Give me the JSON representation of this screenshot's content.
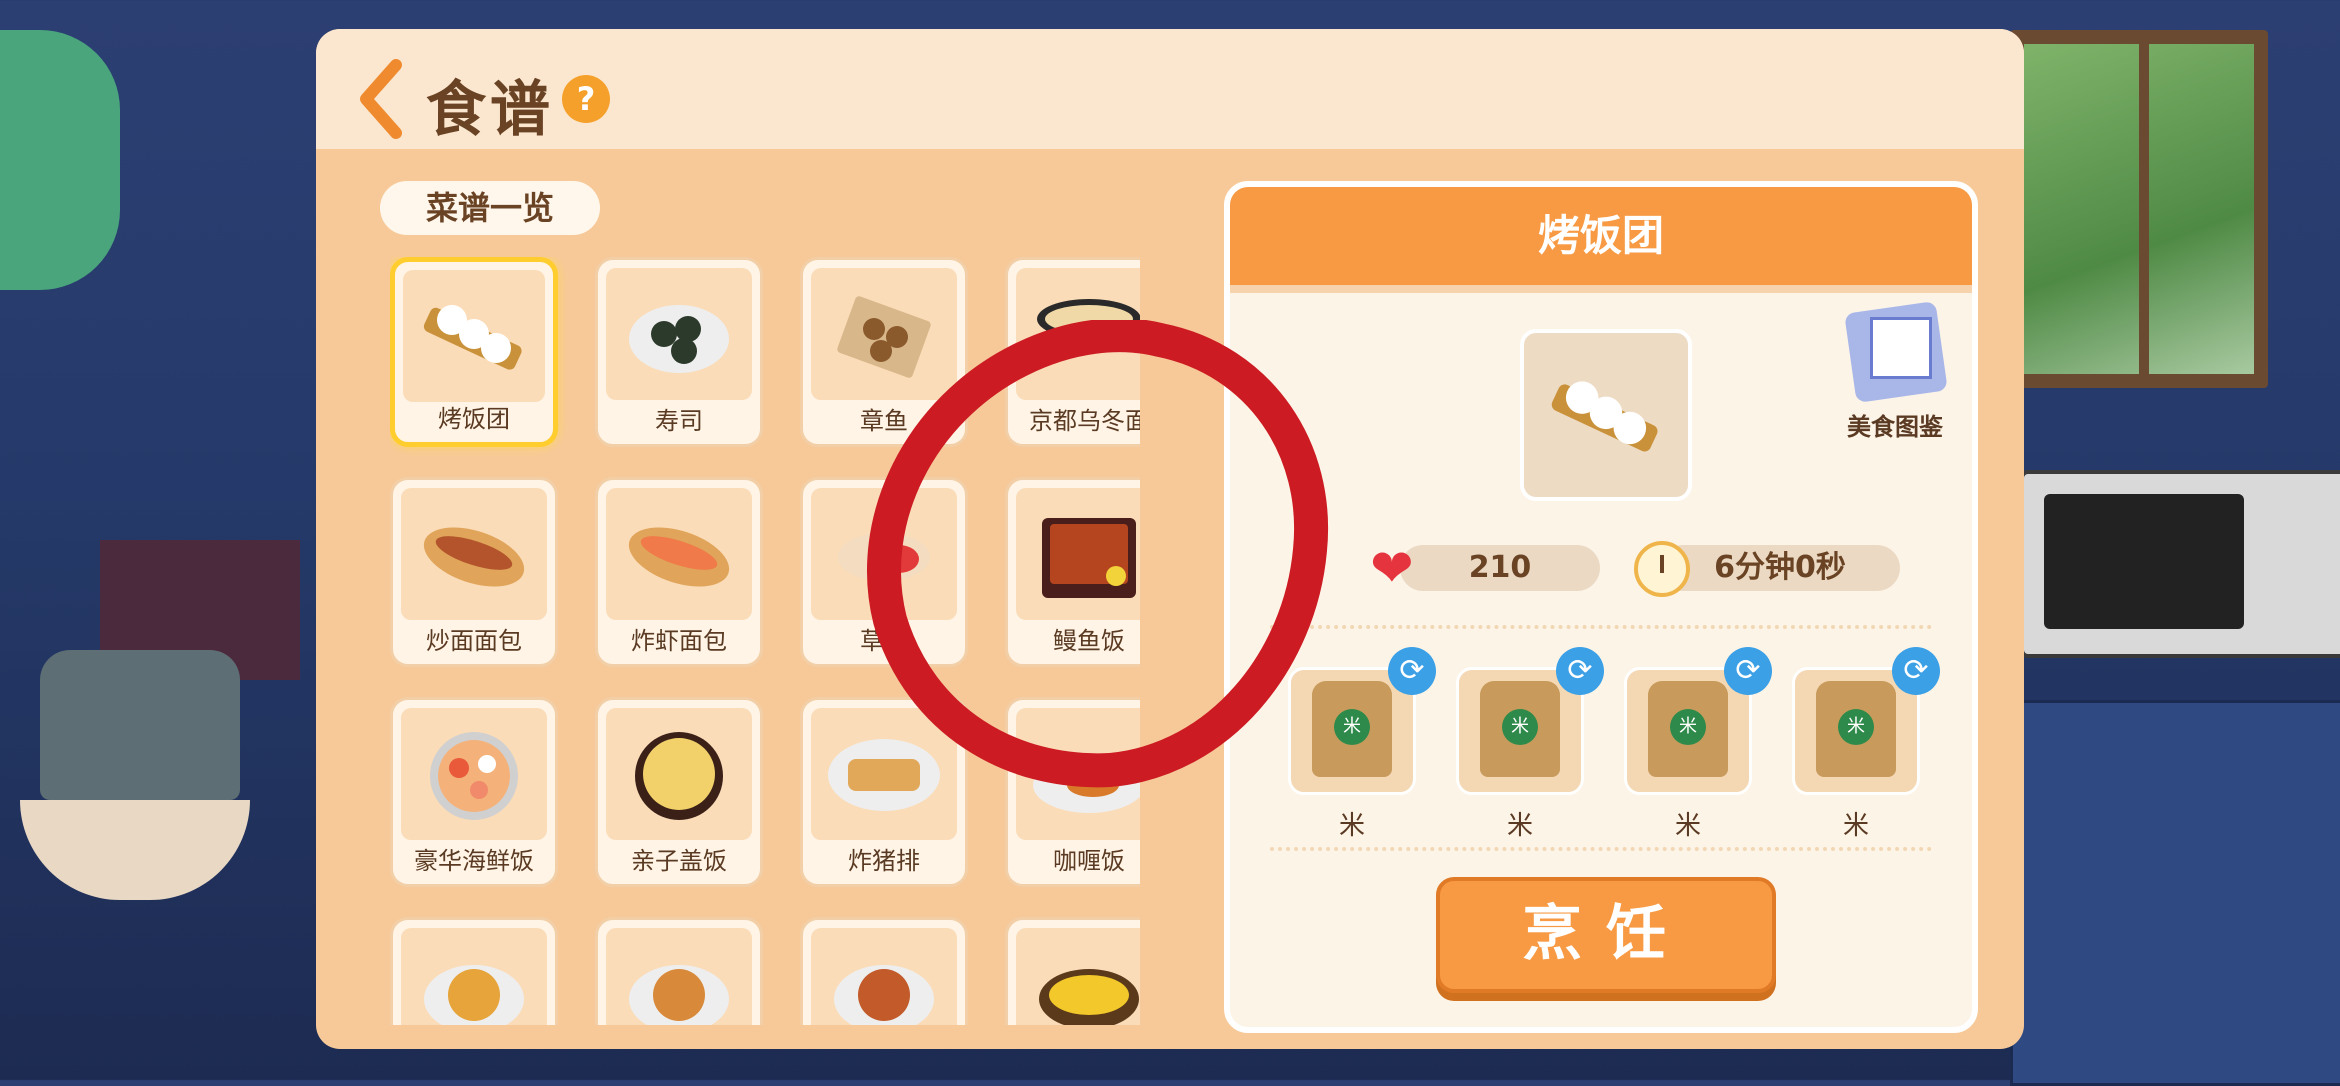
{
  "header": {
    "title": "食谱",
    "help": "?"
  },
  "list": {
    "title": "菜谱一览",
    "items": [
      {
        "label": "烤饭团",
        "selected": true
      },
      {
        "label": "寿司"
      },
      {
        "label": "章鱼"
      },
      {
        "label": "京都乌冬面"
      },
      {
        "label": "炒面面包"
      },
      {
        "label": "炸虾面包"
      },
      {
        "label": "草莓"
      },
      {
        "label": "鳗鱼饭"
      },
      {
        "label": "豪华海鲜饭"
      },
      {
        "label": "亲子盖饭"
      },
      {
        "label": "炸猪排"
      },
      {
        "label": "咖喱饭"
      },
      {
        "label": ""
      },
      {
        "label": ""
      },
      {
        "label": ""
      },
      {
        "label": ""
      }
    ]
  },
  "detail": {
    "title": "烤饭团",
    "album_label": "美食图鉴",
    "hearts": "210",
    "time": "6分钟0秒",
    "ingredients": [
      {
        "name": "米"
      },
      {
        "name": "米"
      },
      {
        "name": "米"
      },
      {
        "name": "米"
      }
    ],
    "cook_label": "烹饪"
  },
  "colors": {
    "accent": "#f79a43",
    "panel": "#f7c999",
    "text": "#6a4324",
    "annotation": "#cc1b22"
  }
}
